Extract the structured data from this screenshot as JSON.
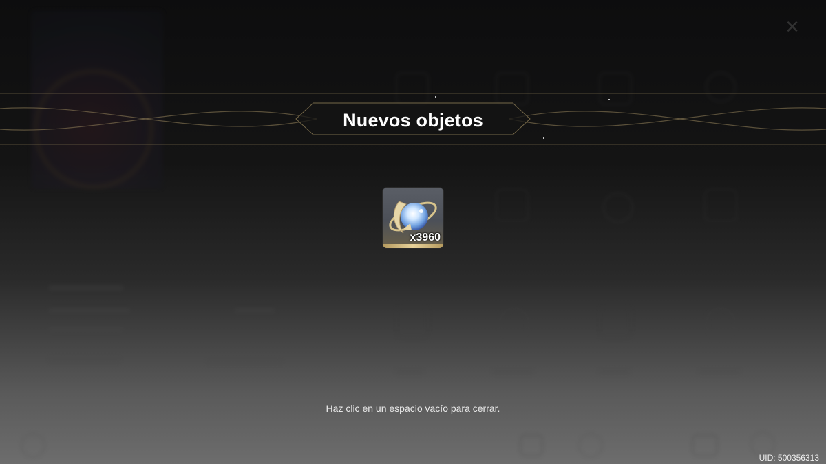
{
  "dialog": {
    "title": "Nuevos objetos",
    "hint": "Haz clic en un espacio vacío para cerrar."
  },
  "reward": {
    "icon": "primogem-icon",
    "quantity": "x3960"
  },
  "footer": {
    "uid": "UID: 500356313"
  },
  "colors": {
    "title": "#ffffff",
    "banner_line": "#8a7a55",
    "slot_bottom": "#e8d29a"
  }
}
